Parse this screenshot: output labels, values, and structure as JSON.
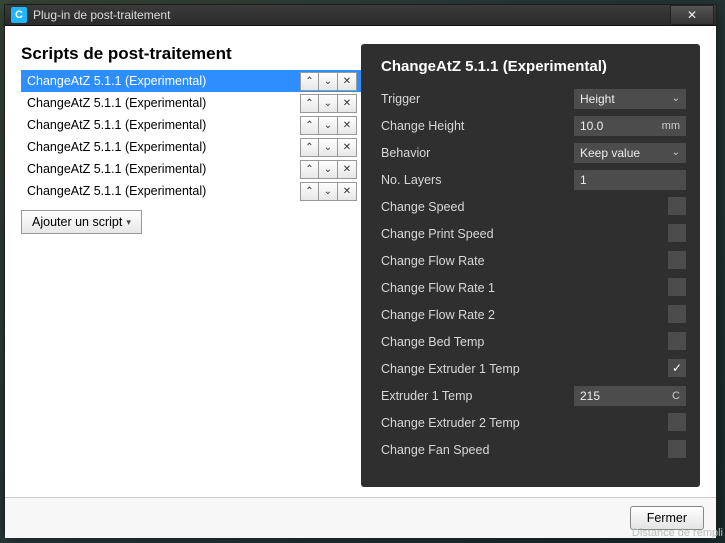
{
  "window": {
    "title": "Plug-in de post-traitement",
    "app_icon_letter": "C",
    "close_glyph": "✕"
  },
  "left": {
    "heading": "Scripts de post-traitement",
    "scripts": [
      {
        "name": "ChangeAtZ 5.1.1 (Experimental)",
        "selected": true
      },
      {
        "name": "ChangeAtZ 5.1.1 (Experimental)",
        "selected": false
      },
      {
        "name": "ChangeAtZ 5.1.1 (Experimental)",
        "selected": false
      },
      {
        "name": "ChangeAtZ 5.1.1 (Experimental)",
        "selected": false
      },
      {
        "name": "ChangeAtZ 5.1.1 (Experimental)",
        "selected": false
      },
      {
        "name": "ChangeAtZ 5.1.1 (Experimental)",
        "selected": false
      }
    ],
    "row_buttons": {
      "up": "⌃",
      "down": "⌄",
      "remove": "✕"
    },
    "add_label": "Ajouter un script",
    "add_arrow": "▾"
  },
  "right": {
    "heading": "ChangeAtZ 5.1.1 (Experimental)",
    "settings": [
      {
        "key": "trigger",
        "label": "Trigger",
        "type": "select",
        "value": "Height"
      },
      {
        "key": "height",
        "label": "Change Height",
        "type": "number",
        "value": "10.0",
        "unit": "mm"
      },
      {
        "key": "behavior",
        "label": "Behavior",
        "type": "select",
        "value": "Keep value"
      },
      {
        "key": "layers",
        "label": "No. Layers",
        "type": "number",
        "value": "1"
      },
      {
        "key": "speed",
        "label": "Change Speed",
        "type": "check",
        "checked": false
      },
      {
        "key": "pspeed",
        "label": "Change Print Speed",
        "type": "check",
        "checked": false
      },
      {
        "key": "flow",
        "label": "Change Flow Rate",
        "type": "check",
        "checked": false
      },
      {
        "key": "flow1",
        "label": "Change Flow Rate 1",
        "type": "check",
        "checked": false
      },
      {
        "key": "flow2",
        "label": "Change Flow Rate 2",
        "type": "check",
        "checked": false
      },
      {
        "key": "bed",
        "label": "Change Bed Temp",
        "type": "check",
        "checked": false
      },
      {
        "key": "ext1c",
        "label": "Change Extruder 1 Temp",
        "type": "check",
        "checked": true
      },
      {
        "key": "ext1t",
        "label": "Extruder 1 Temp",
        "type": "number",
        "value": "215",
        "unit": "C"
      },
      {
        "key": "ext2c",
        "label": "Change Extruder 2 Temp",
        "type": "check",
        "checked": false
      },
      {
        "key": "fan",
        "label": "Change Fan Speed",
        "type": "check",
        "checked": false
      }
    ]
  },
  "footer": {
    "close_label": "Fermer"
  },
  "bg_hint": "Distance de rempli"
}
